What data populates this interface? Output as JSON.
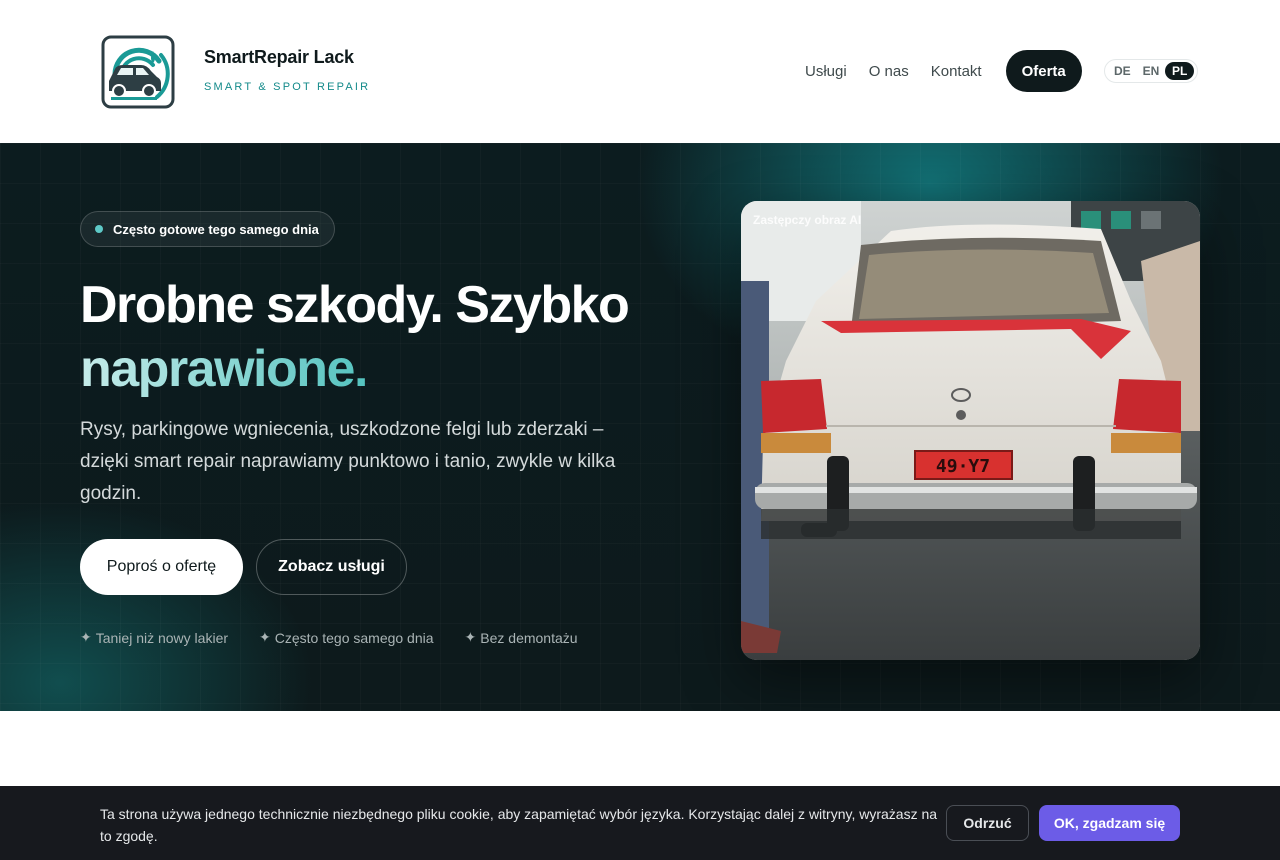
{
  "brand": {
    "name": "SmartRepair Lack",
    "tagline": "SMART & SPOT REPAIR"
  },
  "nav": {
    "items": [
      "Usługi",
      "O nas",
      "Kontakt"
    ],
    "cta": "Oferta"
  },
  "languages": {
    "options": [
      "DE",
      "EN",
      "PL"
    ],
    "active": "PL"
  },
  "hero": {
    "badge": "Często gotowe tego samego dnia",
    "title_part1": "Drobne szkody. Szybko",
    "title_accent": "naprawione.",
    "lead": "Rysy, parkingowe wgniecenia, uszkodzone felgi lub zderzaki – dzięki smart repair naprawiamy punktowo i tanio, zwykle w kilka godzin.",
    "primary_button": "Poproś o ofertę",
    "secondary_button": "Zobacz usługi",
    "perks": [
      "Taniej niż nowy lakier",
      "Często tego samego dnia",
      "Bez demontażu"
    ],
    "perk_icon": "✦",
    "image_caption": "Zastępczy obraz AI",
    "plate": "49·Y7"
  },
  "cookie": {
    "text": "Ta strona używa jednego technicznie niezbędnego pliku cookie, aby zapamiętać wybór języka. Korzystając dalej z witryny, wyrażasz na to zgodę.",
    "refuse": "Odrzuć",
    "accept": "OK, zgadzam się"
  },
  "colors": {
    "accent_teal": "#138a8a",
    "dark": "#0f1a1c",
    "cookie_button": "#6c5ce7"
  }
}
